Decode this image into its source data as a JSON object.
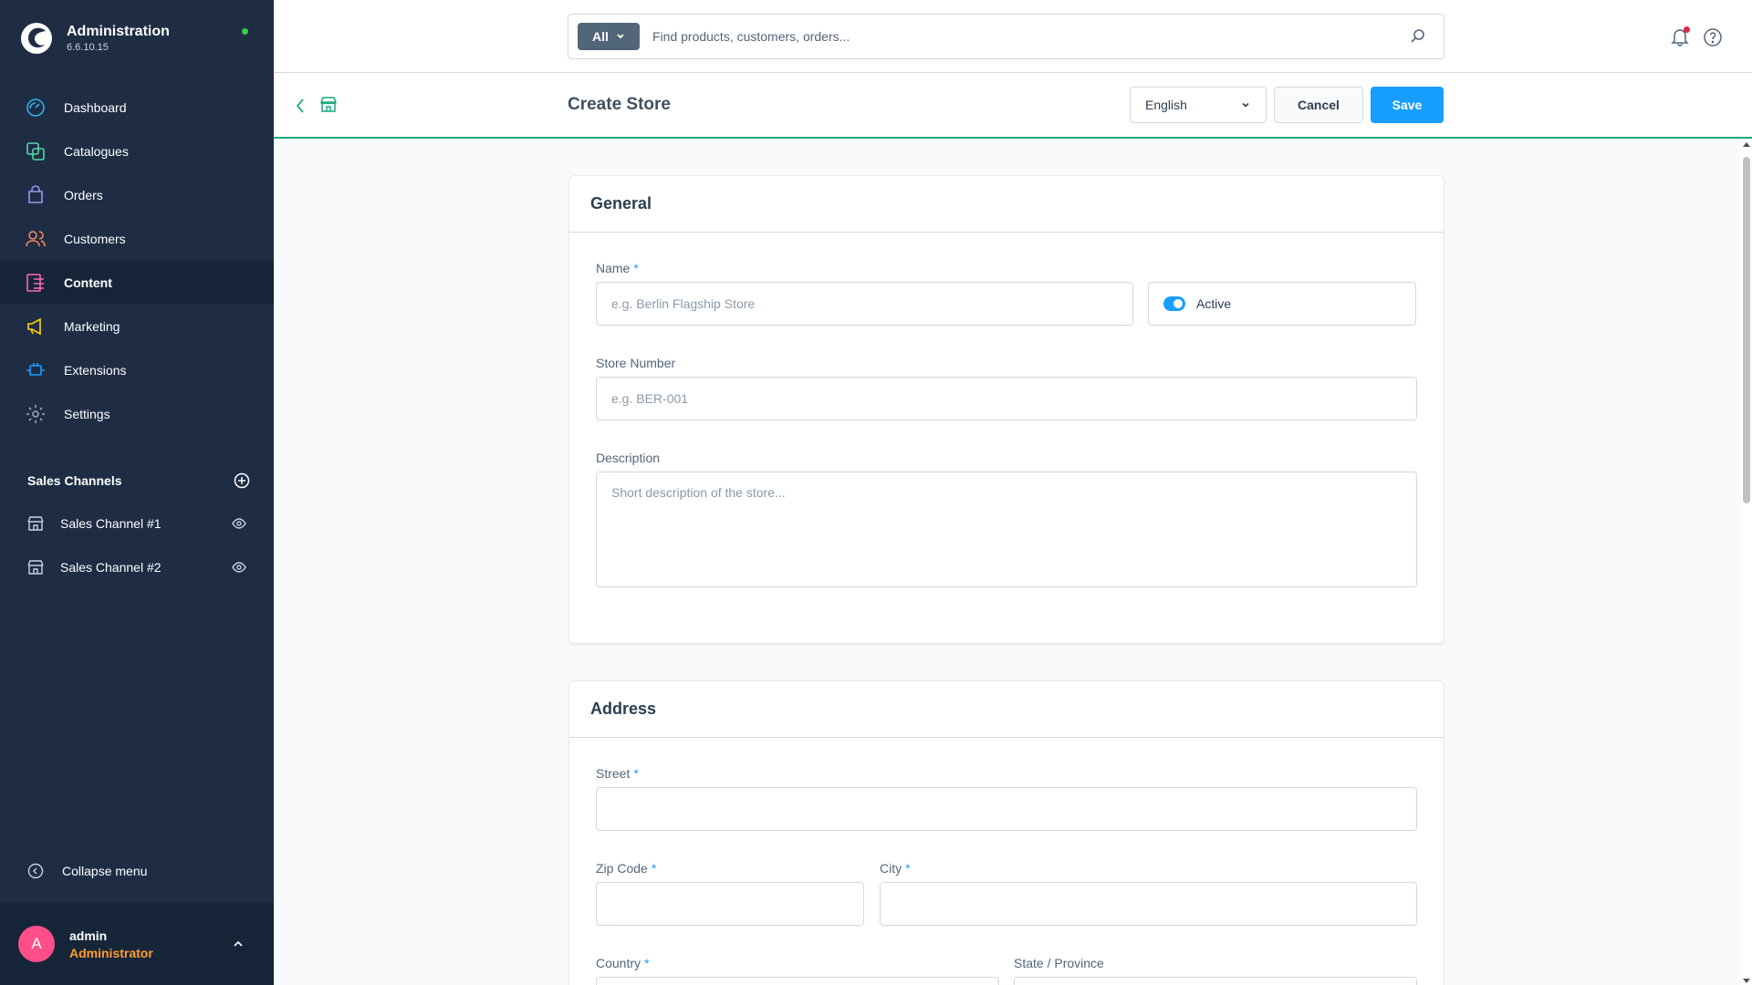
{
  "app": {
    "title": "Administration",
    "version": "6.6.10.15"
  },
  "nav": {
    "items": [
      {
        "label": "Dashboard",
        "icon": "dashboard-icon",
        "color": "#33b0e8"
      },
      {
        "label": "Catalogues",
        "icon": "catalogues-icon",
        "color": "#57d9a3"
      },
      {
        "label": "Orders",
        "icon": "orders-icon",
        "color": "#a092f0"
      },
      {
        "label": "Customers",
        "icon": "customers-icon",
        "color": "#f88962"
      },
      {
        "label": "Content",
        "icon": "content-icon",
        "color": "#ff68b4"
      },
      {
        "label": "Marketing",
        "icon": "marketing-icon",
        "color": "#ffd700"
      },
      {
        "label": "Extensions",
        "icon": "extensions-icon",
        "color": "#189eff"
      },
      {
        "label": "Settings",
        "icon": "settings-icon",
        "color": "#9aa8b5"
      }
    ]
  },
  "sales_channels": {
    "title": "Sales Channels",
    "items": [
      {
        "label": "Sales Channel #1"
      },
      {
        "label": "Sales Channel #2"
      }
    ]
  },
  "collapse_label": "Collapse menu",
  "user": {
    "initial": "A",
    "name": "admin",
    "role": "Administrator"
  },
  "search": {
    "type_label": "All",
    "placeholder": "Find products, customers, orders..."
  },
  "smartbar": {
    "title": "Create Store",
    "language": "English",
    "cancel_label": "Cancel",
    "save_label": "Save"
  },
  "general": {
    "title": "General",
    "name_label": "Name",
    "name_placeholder": "e.g. Berlin Flagship Store",
    "active_label": "Active",
    "active": true,
    "store_number_label": "Store Number",
    "store_number_placeholder": "e.g. BER-001",
    "description_label": "Description",
    "description_placeholder": "Short description of the store..."
  },
  "address": {
    "title": "Address",
    "street_label": "Street",
    "zip_label": "Zip Code",
    "city_label": "City",
    "country_label": "Country",
    "state_label": "State / Province"
  },
  "required_marker": "*",
  "colors": {
    "sidebar": "#1e2d44",
    "accent": "#189eff",
    "success": "#1fa97c",
    "role": "#ff9d2e"
  }
}
